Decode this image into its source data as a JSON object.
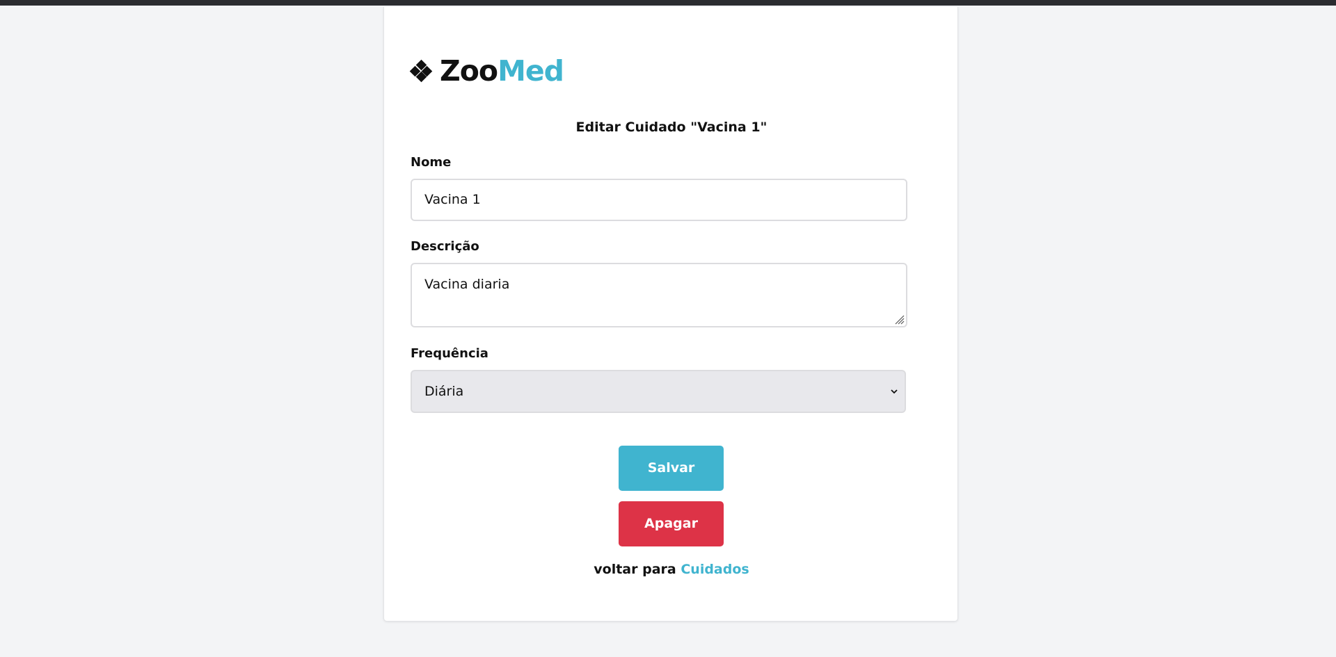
{
  "brand": {
    "name_part1": "Zoo",
    "name_part2": "Med",
    "icon": "four-diamonds-logo-icon",
    "accent_color": "#40b4cf"
  },
  "form": {
    "title": "Editar Cuidado \"Vacina 1\"",
    "fields": {
      "nome": {
        "label": "Nome",
        "value": "Vacina 1"
      },
      "descricao": {
        "label": "Descrição",
        "value": "Vacina diaria"
      },
      "frequencia": {
        "label": "Frequência",
        "selected": "Diária",
        "icon": "chevron-down-icon"
      }
    },
    "save_label": "Salvar",
    "delete_label": "Apagar",
    "save_color": "#40b4cf",
    "delete_color": "#dd3347"
  },
  "footer": {
    "back_prefix": "voltar para",
    "back_link": "Cuidados"
  }
}
